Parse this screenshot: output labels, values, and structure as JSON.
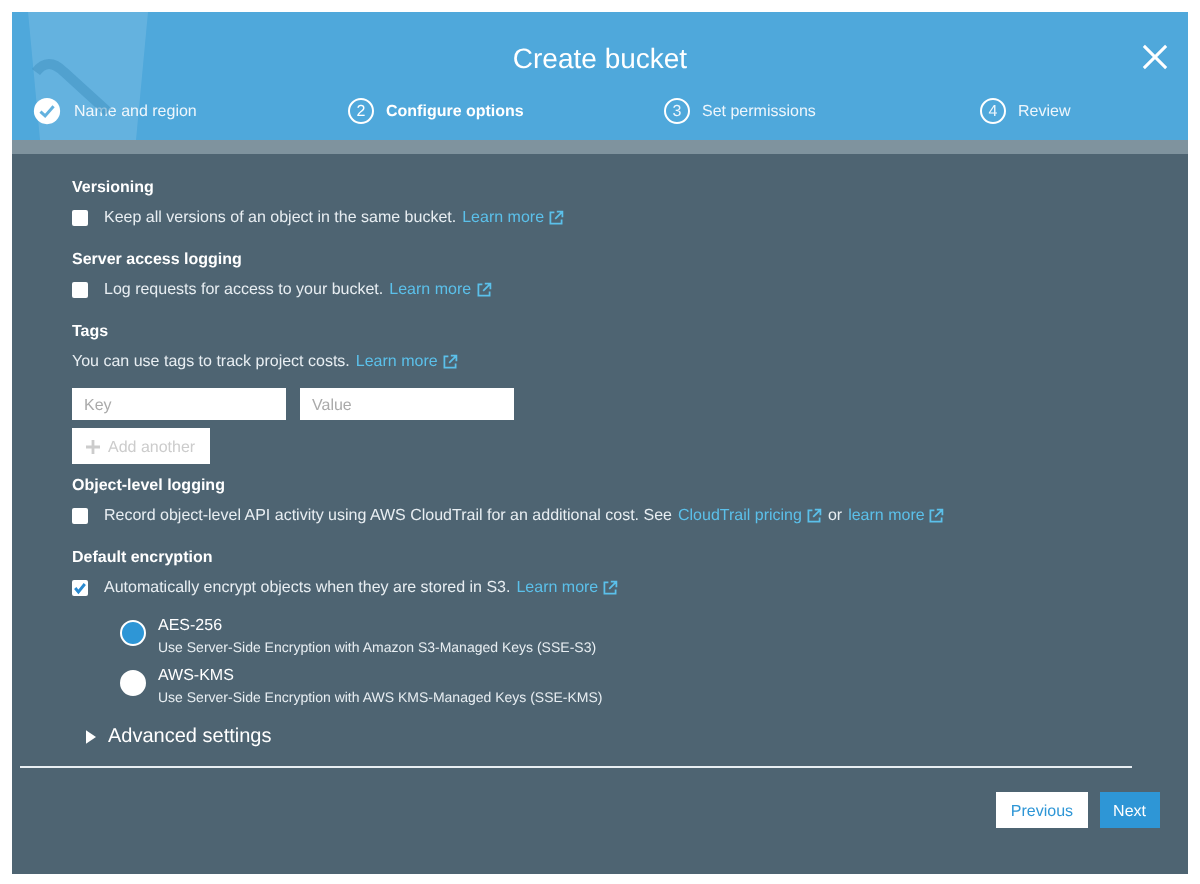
{
  "window": {
    "title": "Create bucket"
  },
  "steps": [
    {
      "label": "Name and region",
      "done": true,
      "selected": false
    },
    {
      "number": "2",
      "label": "Configure options",
      "done": false,
      "selected": true
    },
    {
      "number": "3",
      "label": "Set permissions",
      "done": false,
      "selected": false
    },
    {
      "number": "4",
      "label": "Review",
      "done": false,
      "selected": false
    }
  ],
  "sections": [
    {
      "kind": "checkbox",
      "title": "Versioning",
      "checked": false,
      "parts": [
        {
          "kind": "text",
          "text": "Keep all versions of an object in the same bucket."
        },
        {
          "kind": "link",
          "text": "Learn more"
        }
      ]
    },
    {
      "kind": "checkbox",
      "title": "Server access logging",
      "checked": false,
      "parts": [
        {
          "kind": "text",
          "text": "Log requests for access to your bucket."
        },
        {
          "kind": "link",
          "text": "Learn more"
        }
      ]
    },
    {
      "kind": "tags",
      "title": "Tags",
      "parts": [
        {
          "kind": "text",
          "text": "You can use tags to track project costs."
        },
        {
          "kind": "link",
          "text": "Learn more"
        }
      ],
      "key_placeholder": "Key",
      "value_placeholder": "Value",
      "add_label": "Add another"
    },
    {
      "kind": "checkbox",
      "title": "Object-level logging",
      "checked": false,
      "parts": [
        {
          "kind": "text",
          "text": "Record object-level API activity using AWS CloudTrail for an additional cost. See"
        },
        {
          "kind": "link",
          "text": "CloudTrail pricing"
        },
        {
          "kind": "text",
          "text": "or"
        },
        {
          "kind": "link",
          "text": "learn more"
        }
      ]
    },
    {
      "kind": "checkbox",
      "title": "Default encryption",
      "checked": true,
      "parts": [
        {
          "kind": "text",
          "text": "Automatically encrypt objects when they are stored in S3."
        },
        {
          "kind": "link",
          "text": "Learn more"
        }
      ],
      "options": [
        {
          "label": "AES-256",
          "description": "Use Server-Side Encryption with Amazon S3-Managed Keys (SSE-S3)",
          "selected": true
        },
        {
          "label": "AWS-KMS",
          "description": "Use Server-Side Encryption with AWS KMS-Managed Keys (SSE-KMS)",
          "selected": false
        }
      ]
    }
  ],
  "advanced": {
    "label": "Advanced settings",
    "expanded": false
  },
  "buttons": [
    {
      "label": "Previous",
      "kind": "secondary"
    },
    {
      "label": "Next",
      "kind": "primary"
    }
  ]
}
